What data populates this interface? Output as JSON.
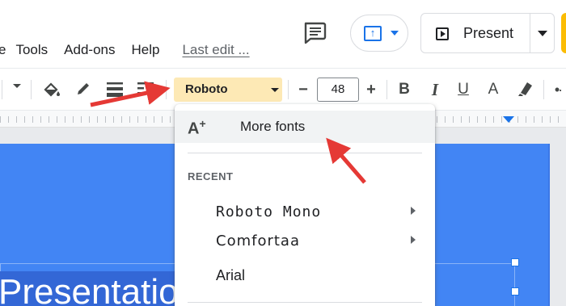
{
  "menu": {
    "items": [
      "e",
      "Tools",
      "Add-ons",
      "Help"
    ],
    "last_edit": "Last edit ..."
  },
  "header": {
    "present_label": "Present",
    "comment_icon": "comment-icon",
    "upload_icon": "upload-icon",
    "share_color": "#fbbc04"
  },
  "toolbar": {
    "font_value": "Roboto",
    "font_size": "48",
    "font_highlight_color": "#fde9b5",
    "decrease_label": "−",
    "increase_label": "+",
    "bold_label": "B",
    "italic_label": "I",
    "underline_label": "U",
    "text_color_label": "A"
  },
  "font_menu": {
    "more_fonts_label": "More fonts",
    "recent_heading": "RECENT",
    "recent": [
      {
        "label": "Roboto Mono",
        "has_submenu": true
      },
      {
        "label": "Comfortaa",
        "has_submenu": true
      },
      {
        "label": "Arial",
        "has_submenu": false
      }
    ]
  },
  "slide": {
    "title_text": "Presentatio",
    "background_color": "#4285f4"
  },
  "annotations": {
    "arrow_color": "#e53935"
  }
}
